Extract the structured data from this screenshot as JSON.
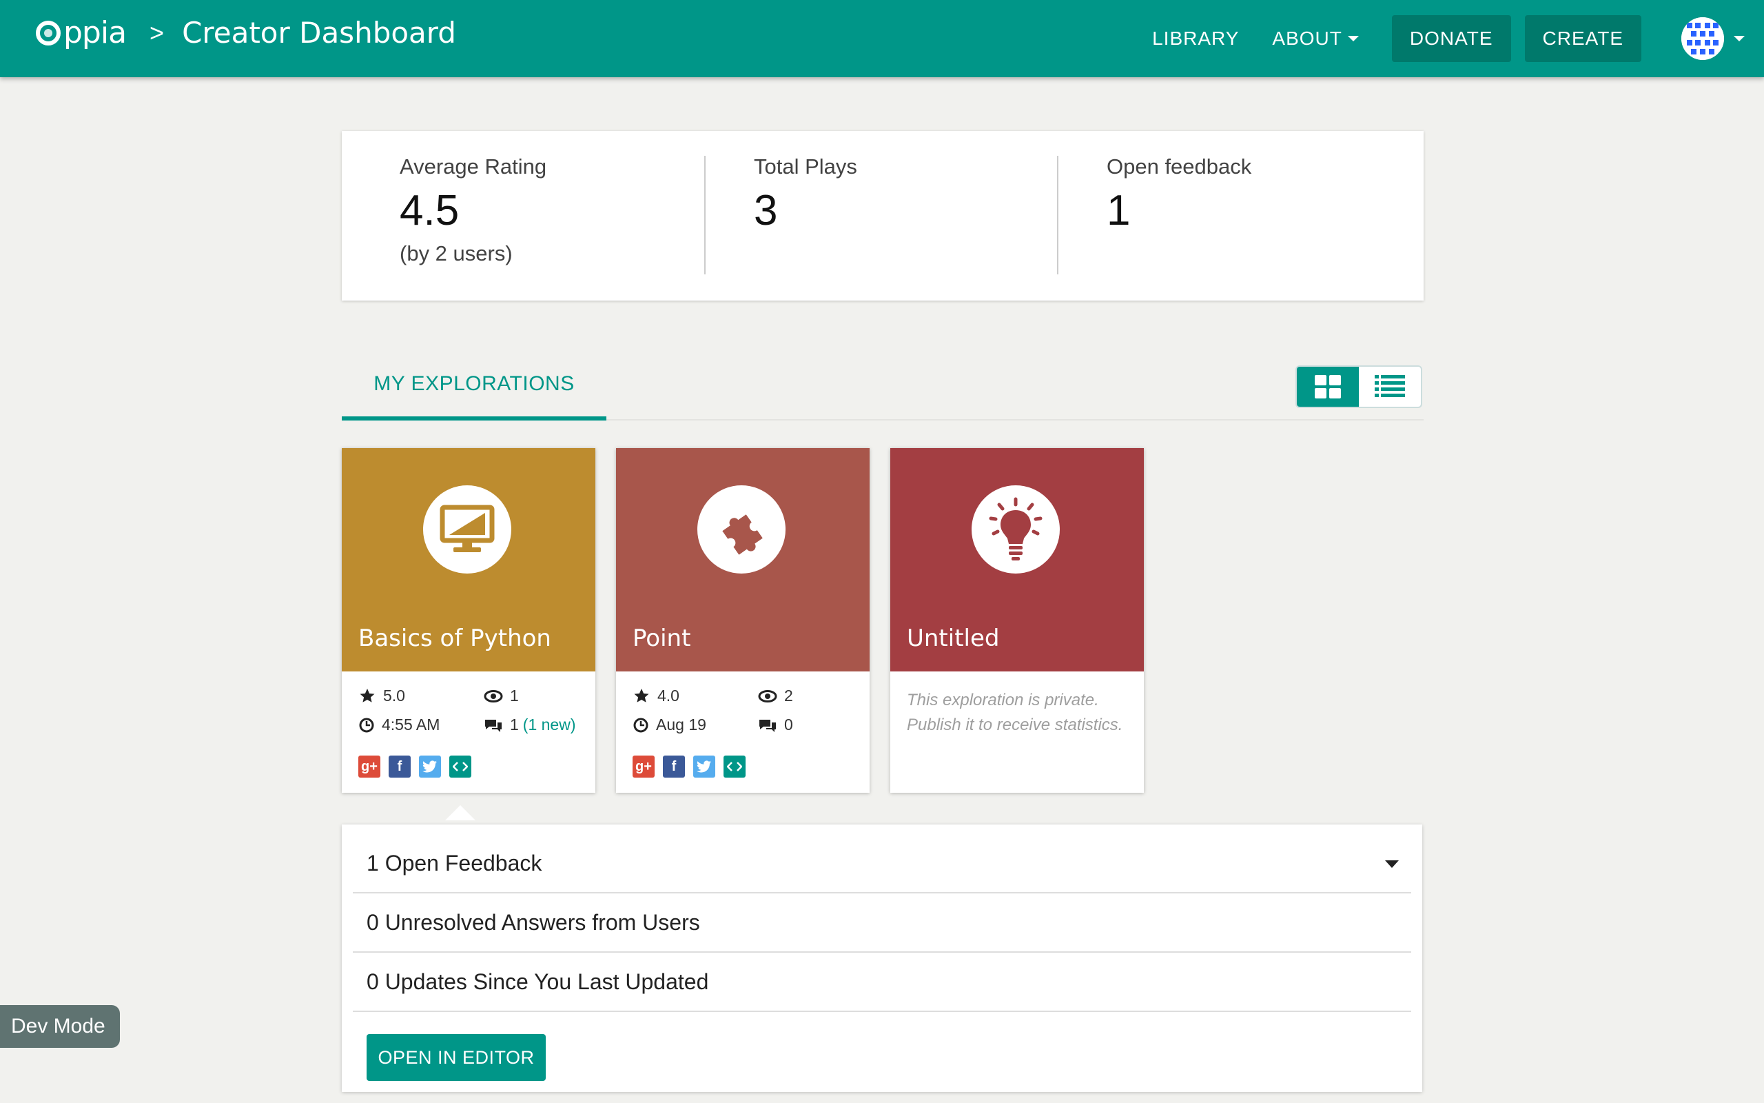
{
  "header": {
    "logo_text": "ppia",
    "breadcrumb_separator": ">",
    "page_title": "Creator Dashboard",
    "nav": {
      "library": "LIBRARY",
      "about": "ABOUT",
      "donate": "DONATE",
      "create": "CREATE"
    },
    "accent_color": "#009688"
  },
  "stats": {
    "average_rating_label": "Average Rating",
    "average_rating_value": "4.5",
    "average_rating_sub": "(by 2 users)",
    "total_plays_label": "Total Plays",
    "total_plays_value": "3",
    "open_feedback_label": "Open feedback",
    "open_feedback_value": "1"
  },
  "tabs": {
    "my_explorations": "MY EXPLORATIONS",
    "view_modes": [
      "grid-view-icon",
      "list-view-icon"
    ],
    "active_view": "grid"
  },
  "explorations": [
    {
      "title": "Basics of Python",
      "color": "#bd8c2f",
      "icon": "monitor-icon",
      "rating": "5.0",
      "views": "1",
      "updated": "4:55 AM",
      "feedback": "1",
      "feedback_new": "(1 new)"
    },
    {
      "title": "Point",
      "color": "#a8564b",
      "icon": "puzzle-icon",
      "rating": "4.0",
      "views": "2",
      "updated": "Aug 19",
      "feedback": "0"
    },
    {
      "title": "Untitled",
      "color": "#a33e42",
      "icon": "lightbulb-icon",
      "private_note": "This exploration is private. Publish it to receive statistics."
    }
  ],
  "feedback_panel": {
    "open_feedback": "1 Open Feedback",
    "unresolved_answers": "0 Unresolved Answers from Users",
    "updates": "0 Updates Since You Last Updated",
    "open_in_editor": "OPEN IN EDITOR"
  },
  "dev_mode": "Dev Mode"
}
